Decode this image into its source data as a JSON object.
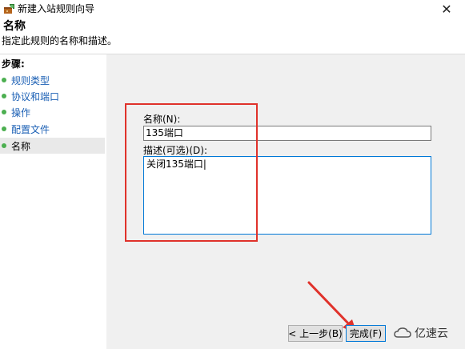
{
  "window": {
    "title": "新建入站规则向导",
    "close_glyph": "✕"
  },
  "header": {
    "title": "名称",
    "description": "指定此规则的名称和描述。"
  },
  "sidebar": {
    "header": "步骤:",
    "items": [
      {
        "label": "规则类型"
      },
      {
        "label": "协议和端口"
      },
      {
        "label": "操作"
      },
      {
        "label": "配置文件"
      },
      {
        "label": "名称",
        "current": true
      }
    ]
  },
  "form": {
    "name_label": "名称(N):",
    "name_value": "135端口",
    "desc_label": "描述(可选)(D):",
    "desc_value": "关闭135端口|"
  },
  "buttons": {
    "back_label": "< 上一步(B)",
    "finish_label": "完成(F)"
  },
  "watermark": {
    "text": "亿速云"
  },
  "colors": {
    "annotation_red": "#e0322b",
    "link_blue": "#1a5fb4",
    "bullet_green": "#4caf50",
    "focus_blue": "#0078d7"
  },
  "icons": {
    "title": "firewall-wizard-icon",
    "close": "close-icon",
    "steps": "green-bullet-icon",
    "watermark": "cloud-logo-icon"
  }
}
